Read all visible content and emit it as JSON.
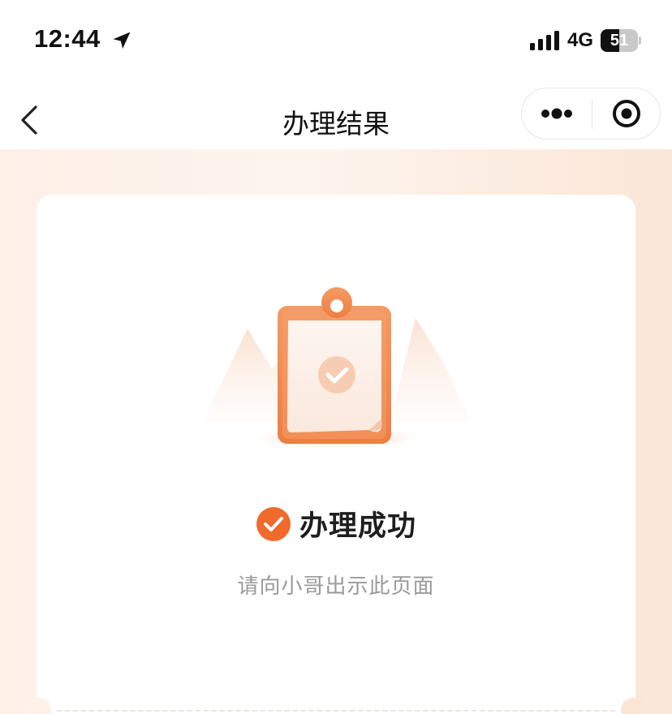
{
  "status_bar": {
    "time": "12:44",
    "network": "4G",
    "battery": "51",
    "battery_level": 0.51,
    "location_icon": "location-arrow-icon",
    "signal_icon": "signal-bars-icon"
  },
  "nav": {
    "title": "办理结果",
    "back_icon": "back-chevron-icon",
    "more_icon": "more-dots-icon",
    "close_icon": "miniprogram-close-icon"
  },
  "result": {
    "title": "办理成功",
    "subtitle": "请向小哥出示此页面",
    "status_icon": "check-circle-icon",
    "illustration": "clipboard-check-illustration"
  },
  "colors": {
    "accent": "#ef6a2c",
    "title": "#1e1e1e",
    "subtitle": "#9a9a9a",
    "background_start": "#fdf0e7",
    "background_end": "#fbe7d7"
  }
}
